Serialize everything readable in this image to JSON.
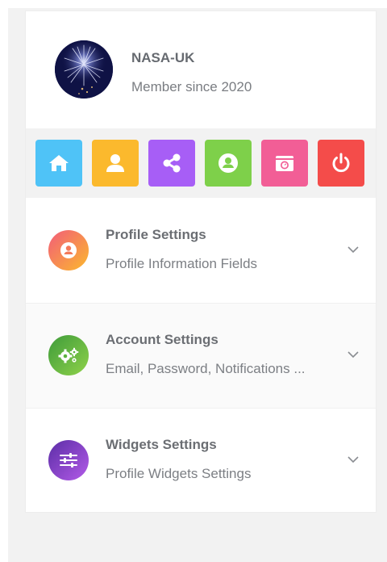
{
  "profile": {
    "username": "NASA-UK",
    "member_since": "Member since 2020"
  },
  "toolbar": {
    "items": [
      {
        "icon": "home-icon",
        "color": "#4fc3f7"
      },
      {
        "icon": "user-icon",
        "color": "#fbb92d"
      },
      {
        "icon": "share-icon",
        "color": "#a75ef6"
      },
      {
        "icon": "user-circle-icon",
        "color": "#7ed04a"
      },
      {
        "icon": "camera-icon",
        "color": "#f25e96"
      },
      {
        "icon": "power-icon",
        "color": "#f44c4a"
      }
    ]
  },
  "settings": [
    {
      "title": "Profile Settings",
      "subtitle": "Profile Information Fields",
      "icon": "user-circle-icon",
      "gradient": [
        "#f25c7a",
        "#fbb92d"
      ]
    },
    {
      "title": "Account Settings",
      "subtitle": "Email, Password, Notifications ...",
      "icon": "gears-icon",
      "gradient": [
        "#3e9b3a",
        "#8fd24a"
      ]
    },
    {
      "title": "Widgets Settings",
      "subtitle": "Profile Widgets Settings",
      "icon": "sliders-icon",
      "gradient": [
        "#5b2da6",
        "#b35be8"
      ]
    }
  ]
}
